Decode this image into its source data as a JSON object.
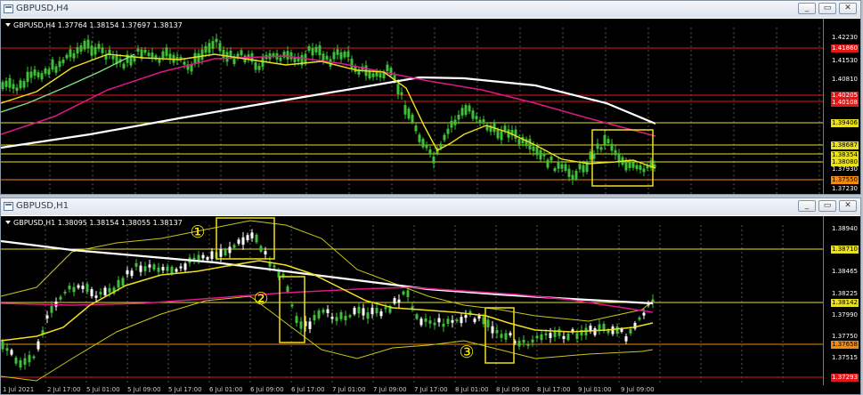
{
  "window_top": {
    "title": "GBPUSD,H4",
    "info": "GBPUSD,H4  1.37764 1.38154 1.37697 1.38137",
    "prices": [
      "1.42230",
      "1.41530",
      "1.40810",
      "1.40090",
      "1.39406",
      "1.38687",
      "1.38354",
      "1.38080",
      "1.37930",
      "1.37550",
      "1.37230"
    ],
    "line_labels": [
      "1.41860",
      "1.40205",
      "1.40108"
    ],
    "times": []
  },
  "window_bottom": {
    "title": "GBPUSD,H1",
    "info": "GBPUSD,H1  1.38095 1.38154 1.38055 1.38137",
    "prices": [
      "1.38940",
      "1.38710",
      "1.38465",
      "1.38225",
      "1.38142",
      "1.37990",
      "1.37750",
      "1.37658",
      "1.37515",
      "1.37293"
    ],
    "times": [
      "1 Jul 2021",
      "2 Jul 17:00",
      "5 Jul 01:00",
      "5 Jul 09:00",
      "5 Jul 17:00",
      "6 Jul 01:00",
      "6 Jul 09:00",
      "6 Jul 17:00",
      "7 Jul 01:00",
      "7 Jul 09:00",
      "7 Jul 17:00",
      "8 Jul 01:00",
      "8 Jul 09:00",
      "8 Jul 17:00",
      "9 Jul 01:00",
      "9 Jul 09:00"
    ]
  },
  "annotations": [
    "①",
    "②",
    "③"
  ],
  "buttons": {
    "minimize": "_",
    "restore": "▭",
    "close": "✕"
  },
  "colors": {
    "ma_long": "#ffffff",
    "ma_mid": "#e0168a",
    "ma_short": "#f0e020",
    "bands": "#c8c81a",
    "candle": "#3fbf3a",
    "level_red": "#e01818",
    "level_yellow": "#e8e020",
    "level_orange": "#f08a10"
  }
}
